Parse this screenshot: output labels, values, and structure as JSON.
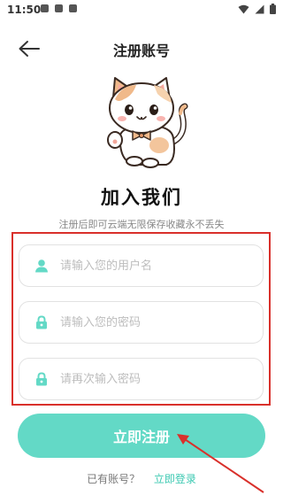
{
  "status_bar": {
    "time": "11:50"
  },
  "app_bar": {
    "title": "注册账号"
  },
  "hero": {
    "heading": "加入我们",
    "subtitle": "注册后即可云端无限保存收藏永不丢失"
  },
  "form": {
    "username": {
      "placeholder": "请输入您的用户名",
      "value": ""
    },
    "password": {
      "placeholder": "请输入您的密码",
      "value": ""
    },
    "confirm_password": {
      "placeholder": "请再次输入密码",
      "value": ""
    }
  },
  "actions": {
    "register_label": "立即注册",
    "have_account_text": "已有账号？",
    "login_link": "立即登录"
  },
  "colors": {
    "accent": "#63d9c6",
    "link": "#3cc9b2",
    "annotation": "#d9302b"
  }
}
